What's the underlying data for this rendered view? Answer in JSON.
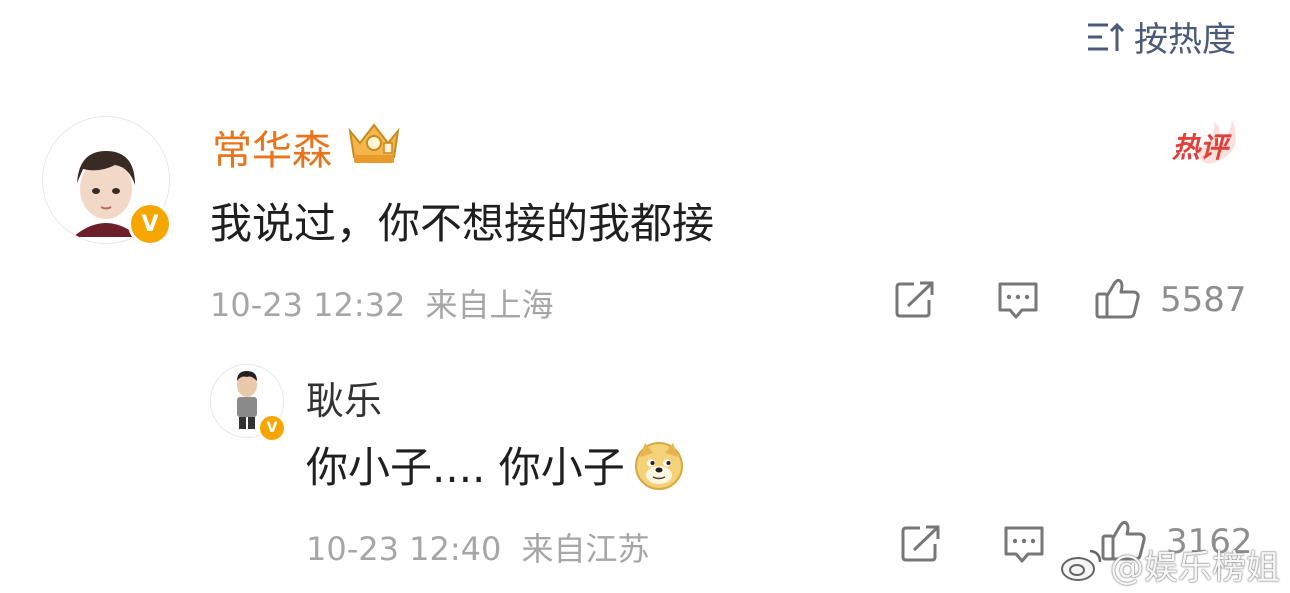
{
  "sort": {
    "label": "按热度"
  },
  "comment": {
    "author": "常华森",
    "hot_badge": "热评",
    "text": "我说过，你不想接的我都接",
    "time": "10-23 12:32",
    "location": "来自上海",
    "likes": "5587"
  },
  "reply": {
    "author": "耿乐",
    "text": "你小子.... 你小子",
    "time": "10-23 12:40",
    "location": "来自江苏",
    "likes": "3162"
  },
  "watermark": {
    "text": "@娱乐榜姐"
  },
  "colors": {
    "author_highlight": "#e8741b",
    "hot_badge": "#e0403a",
    "verified_badge": "#f7a600",
    "meta_gray": "#a6a6a6"
  }
}
